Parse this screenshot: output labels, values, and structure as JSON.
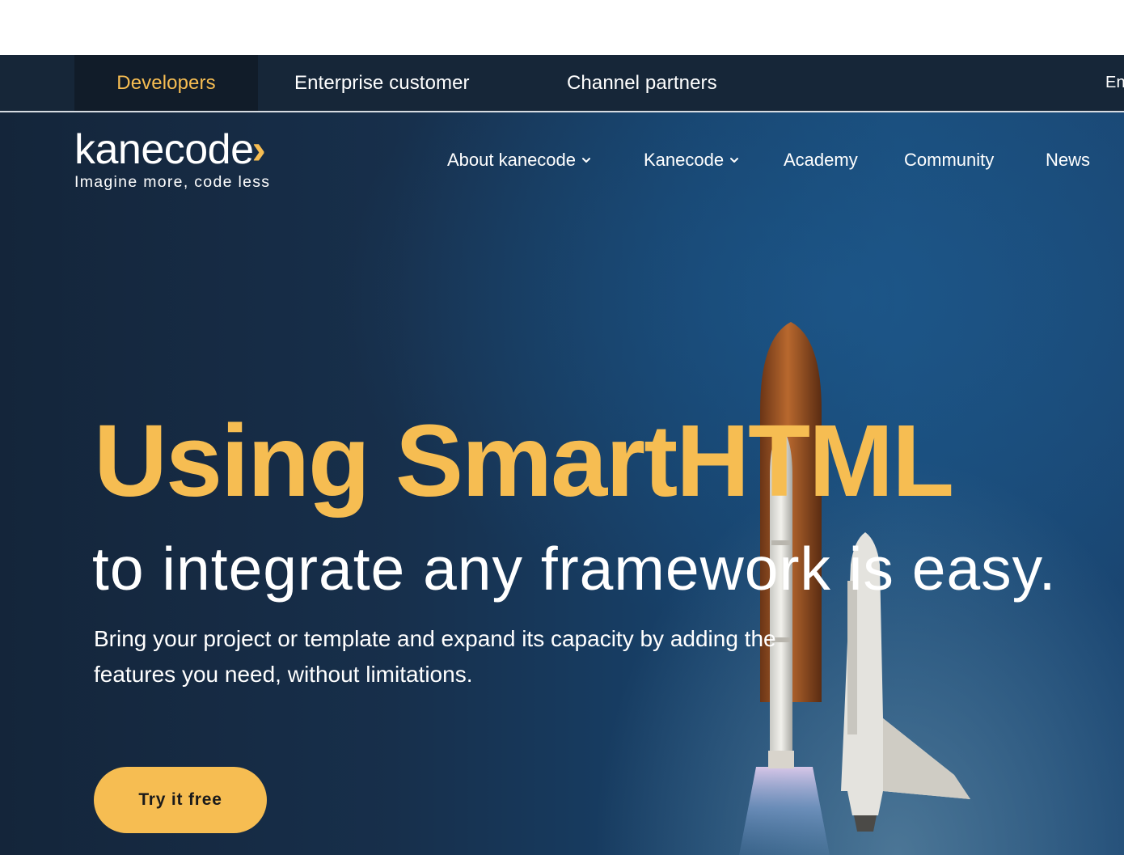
{
  "segments": {
    "developers": "Developers",
    "enterprise": "Enterprise customer",
    "channel": "Channel partners",
    "language": "En"
  },
  "logo": {
    "wordmark": "kanecode",
    "chevron": "›",
    "tagline": "Imagine more, code less"
  },
  "nav": {
    "about": "About kanecode",
    "kanecode": "Kanecode",
    "academy": "Academy",
    "community": "Community",
    "news": "News"
  },
  "hero": {
    "headline": "Using SmartHTML",
    "subheadline": "to integrate any framework is easy.",
    "description": "Bring your project or template and expand its capacity by adding the features you need, without limitations.",
    "cta_label": "Try it free"
  },
  "colors": {
    "accent": "#f6bd52",
    "background_dark": "#14253a",
    "background_blue": "#1a4b78",
    "text": "#ffffff"
  },
  "icons": [
    "chevron-down-icon",
    "rocket-illustration"
  ]
}
